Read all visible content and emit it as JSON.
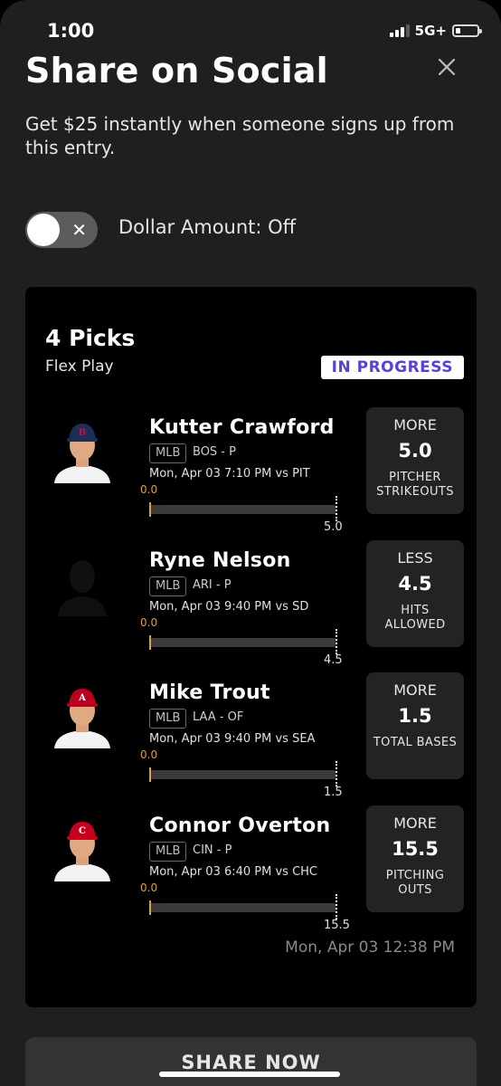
{
  "status_bar": {
    "time": "1:00",
    "network": "5G+"
  },
  "header": {
    "title": "Share on Social",
    "subtitle": "Get $25 instantly when someone signs up from this entry."
  },
  "toggle": {
    "label": "Dollar Amount: Off",
    "on": false
  },
  "card": {
    "picks_count": "4 Picks",
    "play_type": "Flex Play",
    "status": "IN PROGRESS",
    "timestamp": "Mon, Apr 03 12:38 PM",
    "picks": [
      {
        "name": "Kutter Crawford",
        "league": "MLB",
        "team_pos": "BOS - P",
        "game": "Mon, Apr 03 7:10 PM  vs PIT",
        "current": "0.0",
        "target": "5.0",
        "direction": "MORE",
        "line": "5.0",
        "stat": "PITCHER STRIKEOUTS",
        "cap_color": "#1d2d5a",
        "cap_letter": "B"
      },
      {
        "name": "Ryne Nelson",
        "league": "MLB",
        "team_pos": "ARI - P",
        "game": "Mon, Apr 03 9:40 PM  vs SD",
        "current": "0.0",
        "target": "4.5",
        "direction": "LESS",
        "line": "4.5",
        "stat": "HITS ALLOWED",
        "cap_color": "",
        "cap_letter": ""
      },
      {
        "name": "Mike Trout",
        "league": "MLB",
        "team_pos": "LAA - OF",
        "game": "Mon, Apr 03 9:40 PM  vs SEA",
        "current": "0.0",
        "target": "1.5",
        "direction": "MORE",
        "line": "1.5",
        "stat": "TOTAL BASES",
        "cap_color": "#ba0021",
        "cap_letter": "A"
      },
      {
        "name": "Connor Overton",
        "league": "MLB",
        "team_pos": "CIN - P",
        "game": "Mon, Apr 03 6:40 PM  vs CHC",
        "current": "0.0",
        "target": "15.5",
        "direction": "MORE",
        "line": "15.5",
        "stat": "PITCHING OUTS",
        "cap_color": "#c6011f",
        "cap_letter": "C"
      }
    ]
  },
  "share_button": {
    "label": "SHARE NOW"
  },
  "colors": {
    "accent_purple": "#5b3fd6",
    "progress_orange": "#e0a040"
  }
}
